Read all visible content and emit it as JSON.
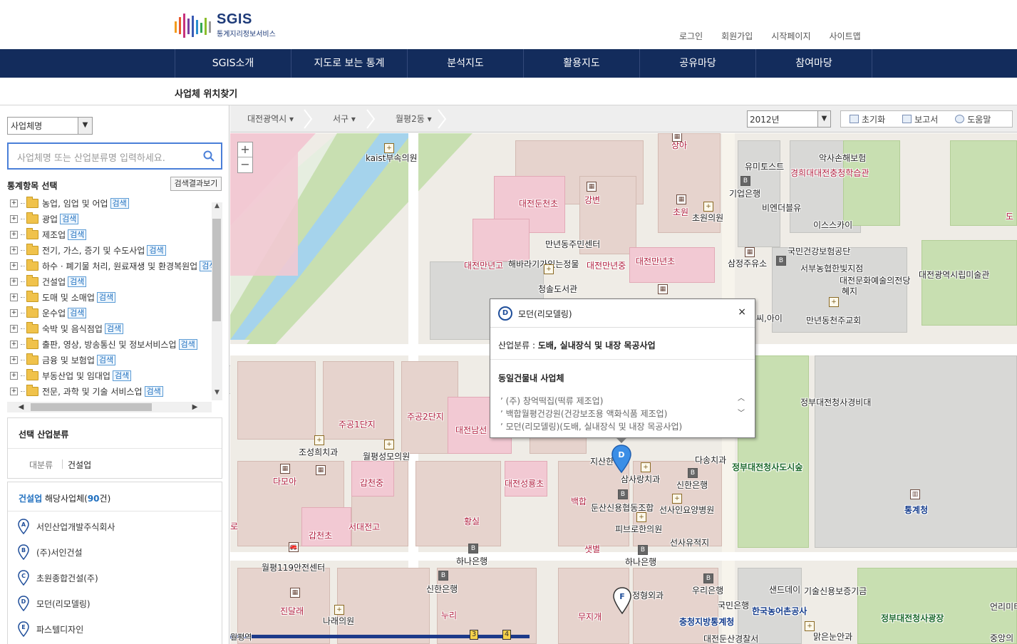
{
  "logo": {
    "title": "SGIS",
    "subtitle": "통계지리정보서비스"
  },
  "util_links": [
    "로그인",
    "회원가입",
    "시작페이지",
    "사이트맵"
  ],
  "gnb": [
    "SGIS소개",
    "지도로 보는 통계",
    "분석지도",
    "활용지도",
    "공유마당",
    "참여마당"
  ],
  "page_title": "사업체 위치찾기",
  "left": {
    "select_value": "사업체명",
    "search_placeholder": "사업체명 또는 산업분류명 입력하세요.",
    "stat_title": "통계항목 선택",
    "result_button": "검색결과보기",
    "search_tag": "검색",
    "tree": [
      "농업, 임업 및 어업",
      "광업",
      "제조업",
      "전기, 가스, 증기 및 수도사업",
      "하수 · 폐기물 처리, 원료재생 및 환경복원업",
      "건설업",
      "도매 및 소매업",
      "운수업",
      "숙박 및 음식점업",
      "출판, 영상, 방송통신 및 정보서비스업",
      "금융 및 보험업",
      "부동산업 및 임대업",
      "전문, 과학 및 기술 서비스업"
    ],
    "selected_title": "선택 산업분류",
    "selected_level": "대분류",
    "selected_value": "건설업",
    "list_industry": "건설업",
    "list_suffix": " 해당사업체(",
    "list_count": "90",
    "list_end": "건)",
    "companies": [
      {
        "marker": "A",
        "name": "서인산업개발주식회사"
      },
      {
        "marker": "B",
        "name": "(주)서인건설"
      },
      {
        "marker": "C",
        "name": "초원종합건설(주)"
      },
      {
        "marker": "D",
        "name": "모던(리모델링)"
      },
      {
        "marker": "E",
        "name": "파스텔디자인"
      }
    ]
  },
  "map_top": {
    "breadcrumb": [
      "대전광역시",
      "서구",
      "월평2동"
    ],
    "year": "2012년",
    "tools": [
      "초기화",
      "보고서",
      "도움말"
    ]
  },
  "zoom": {
    "in": "+",
    "out": "−"
  },
  "popup": {
    "marker": "D",
    "title": "모던(리모델링)",
    "close": "×",
    "category_label": "산업분류 : ",
    "category_value": "도배, 실내장식 및 내장 목공사업",
    "same_building_title": "동일건물내 사업체",
    "same_building": [
      "(주) 창억떡집(떡류 제조업)",
      "백합월평건강원(건강보조용 액화식품 제조업)",
      "모던(리모델링)(도배, 실내장식 및 내장 목공사업)"
    ]
  },
  "map_labels": {
    "kaist": "kaist부속의원",
    "sanga": "상아",
    "yumitost": "유미토스트",
    "aksa": "악사손해보험",
    "kyunghee": "경희대대전충청학습관",
    "dunchoncho": "대전둔천초",
    "gangbyeon": "강변",
    "giup": "기업은행",
    "bienna": "비엔더블유",
    "chowon": "초원",
    "chowonui": "초원의원",
    "isky": "이스스카이",
    "manyeon_center": "만년동주민센터",
    "gukmin_gun": "국민건강보험공단",
    "manyeongo": "대전만년고",
    "habara": "해바라기가있는정물",
    "manyeonjung": "대전만년중",
    "manyeoncho": "대전만년초",
    "samjeong": "삼정주유소",
    "seobu": "서부농협한빛지점",
    "munhwa": "대전문화예술의전당",
    "art": "대전광역시립미술관",
    "cheongsol": "청솔도서관",
    "hyeji": "혜지",
    "ssi": "씨,아이",
    "manyeon_church": "만년동천주교회",
    "jugong1": "주공1단지",
    "jugong2": "주공2단지",
    "nam": "대전남선",
    "gov_guard": "정부대전청사경비대",
    "joseong": "조성희치과",
    "wolpyeong_clinic": "월평성모의원",
    "jisan": "지산한",
    "dasong": "다송치과",
    "gov_square_park": "정부대전청사도시숲",
    "damoa": "다모아",
    "galcheonjung": "갑천중",
    "sungryong": "대전성룡초",
    "baekhap": "백합",
    "samsarang": "삼사랑치과",
    "shinhan1": "신한은행",
    "dunsan_coop": "둔산신용협동조합",
    "seoin_hosp": "선사인요양병원",
    "stats_agency": "통계청",
    "ro": "로",
    "galcheoncho": "갑천초",
    "seodae": "서대전고",
    "hwangsil": "황실",
    "pibu": "피브로한의원",
    "seonsa": "선사유적지",
    "saebyeol": "샛별",
    "fire": "월평119안전센터",
    "hana1": "하나은행",
    "hana2": "하나은행",
    "shinhan2": "신한은행",
    "woori": "우리은행",
    "sandday": "샌드데이",
    "credit": "기술신용보증기금",
    "online": "언리미티",
    "jindallae": "진달래",
    "nuri": "누리",
    "naraeui": "나래의원",
    "mugunghwa": "무지개",
    "jeonghyung": "정형외과",
    "gukmin_bank": "국민은행",
    "farm": "한국농어촌공사",
    "gov_plaza": "정부대전청사광장",
    "chungcheong_stats": "충청지방통계청",
    "dunsan_police": "대전둔산경찰서",
    "malgeun": "맑은눈안과",
    "jungang": "중앙의",
    "wolpyeong_st": "월평역",
    "exit3": "3",
    "exit4": "4",
    "do": "도"
  },
  "colors": {
    "nav": "#132c5c",
    "accent": "#1f6fbf",
    "search_border": "#4a7fd8"
  }
}
